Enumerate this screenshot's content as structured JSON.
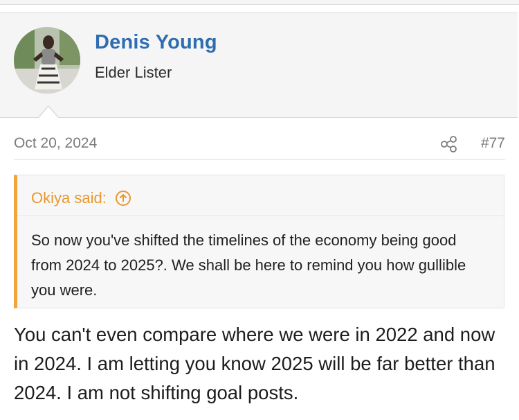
{
  "user": {
    "name": "Denis Young",
    "title": "Elder Lister"
  },
  "post": {
    "date": "Oct 20, 2024",
    "number": "#77",
    "body": "You can't even compare where we were in 2022 and now in 2024. I am letting you know 2025 will be far better than 2024. I am not shifting goal posts."
  },
  "quote": {
    "author_label": "Okiya said:",
    "text": "So now you've shifted the timelines of the economy being good from 2024 to 2025?. We shall be here to remind you how gullible you were."
  },
  "icons": {
    "share": "share-icon",
    "quote_jump": "arrow-up-circle-icon"
  },
  "colors": {
    "username": "#2f6db0",
    "quote_accent": "#f0a43a",
    "meta_text": "#7b7b7b"
  }
}
